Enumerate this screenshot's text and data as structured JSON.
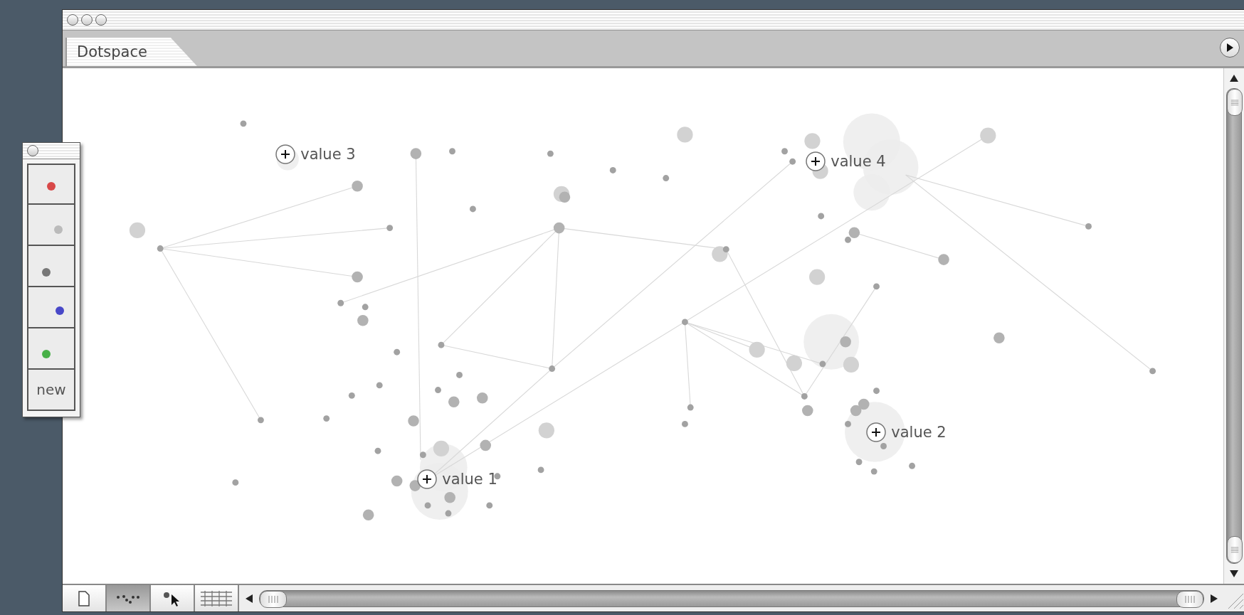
{
  "window": {
    "tab": "Dotspace"
  },
  "palette": {
    "swatches": [
      {
        "color": "#d84848"
      },
      {
        "color": "#bbbbbb"
      },
      {
        "color": "#777777"
      },
      {
        "color": "#4848c8"
      },
      {
        "color": "#48b048"
      }
    ],
    "new_button": "new"
  },
  "markers": [
    {
      "label": "value 3"
    },
    {
      "label": "value 4"
    },
    {
      "label": "value 2"
    },
    {
      "label": "value 1"
    }
  ],
  "toolbar": {
    "tools": [
      {
        "kind": "document",
        "selected": false
      },
      {
        "kind": "dots",
        "selected": true
      },
      {
        "kind": "pointer",
        "selected": false
      },
      {
        "kind": "grid",
        "selected": false
      }
    ]
  }
}
